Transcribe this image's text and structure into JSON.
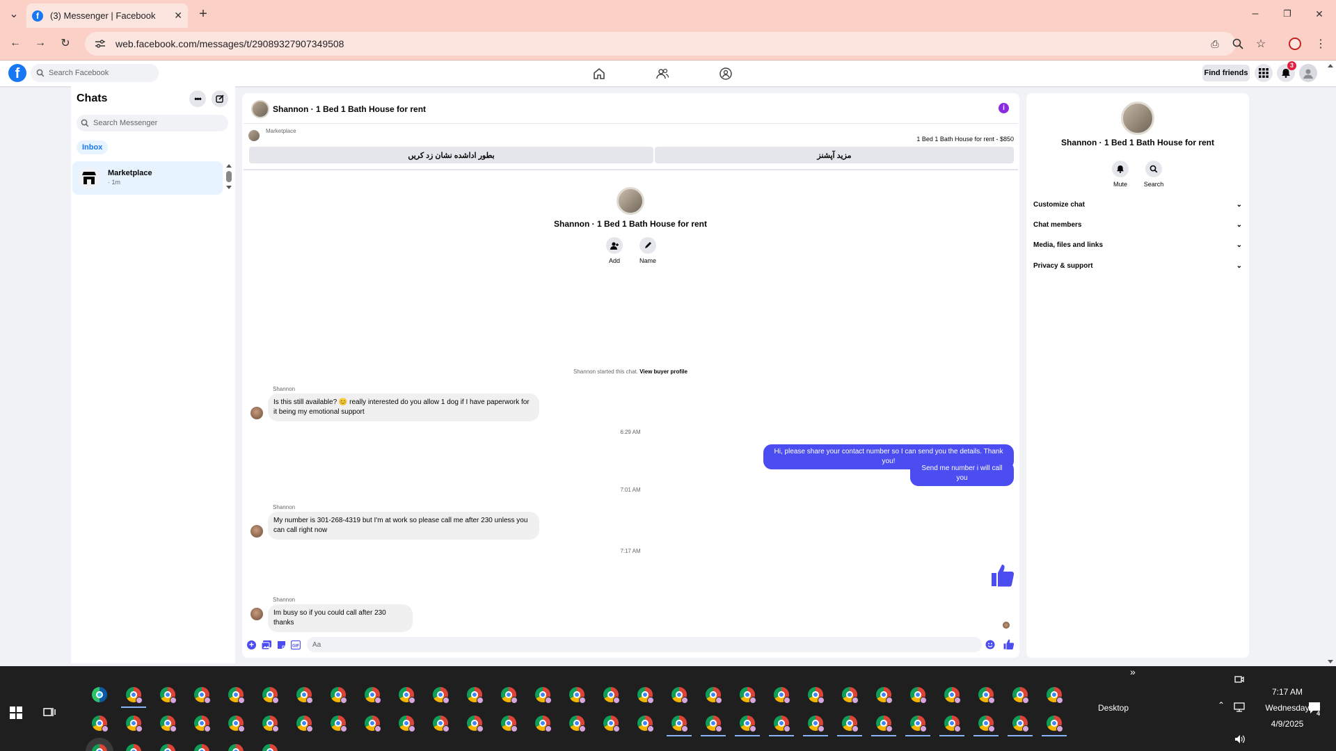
{
  "browser": {
    "tab_title": "(3) Messenger | Facebook",
    "favicon_letter": "f",
    "new_tab": "+",
    "close_tab": "✕",
    "url": "web.facebook.com/messages/t/29089327907349508"
  },
  "fb_header": {
    "logo": "f",
    "search_placeholder": "Search Facebook",
    "find_friends": "Find friends",
    "notification_count": "3"
  },
  "sidebar": {
    "title": "Chats",
    "search_placeholder": "Search Messenger",
    "inbox_label": "Inbox",
    "conversation": {
      "name": "Marketplace",
      "time": "· 1m"
    }
  },
  "conversation": {
    "title": "Shannon · 1 Bed 1 Bath House for rent",
    "marketplace_label": "Marketplace",
    "listing": "1 Bed 1 Bath House for rent - $850",
    "btn_mark_pending": "بطور اداشده نشان زد کریں",
    "btn_more_options": "مزید آپشنز",
    "actions": [
      {
        "icon": "add-person-icon",
        "label": "Add"
      },
      {
        "icon": "pencil-icon",
        "label": "Name"
      }
    ],
    "system_message": "Shannon started this chat.",
    "view_buyer_profile": "View buyer profile",
    "messages": [
      {
        "sender": "Shannon",
        "text": "Is this still available? 😊 really interested do you allow 1 dog if I have paperwork for it being my emotional support"
      },
      {
        "timestamp": "6:29 AM"
      },
      {
        "out1": "Hi, please share your contact number so I can send you the details. Thank you!"
      },
      {
        "out2": "Send me number i will call you"
      },
      {
        "timestamp": "7:01 AM"
      },
      {
        "sender": "Shannon",
        "text": "My number is 301-268-4319 but I'm at work so please call me after 230 unless you can call right now"
      },
      {
        "timestamp": "7:17 AM"
      },
      {
        "sender": "Shannon",
        "text": "Im busy so if you could call after 230 thanks"
      }
    ],
    "composer_placeholder": "Aa"
  },
  "info_panel": {
    "name": "Shannon · 1 Bed 1 Bath House for rent",
    "mute_label": "Mute",
    "search_label": "Search",
    "sections": [
      "Customize chat",
      "Chat members",
      "Media, files and links",
      "Privacy & support"
    ]
  },
  "taskbar": {
    "desktop_label": "Desktop",
    "time": "7:17 AM",
    "day": "Wednesday",
    "date": "4/9/2025",
    "notification_count": "4",
    "overflow": "»"
  },
  "colors": {
    "brand": "#1877f2",
    "outgoing_bubble": "#4b4df0",
    "browser_chrome": "#fbd0c6",
    "taskbar": "#1f1f1f"
  }
}
